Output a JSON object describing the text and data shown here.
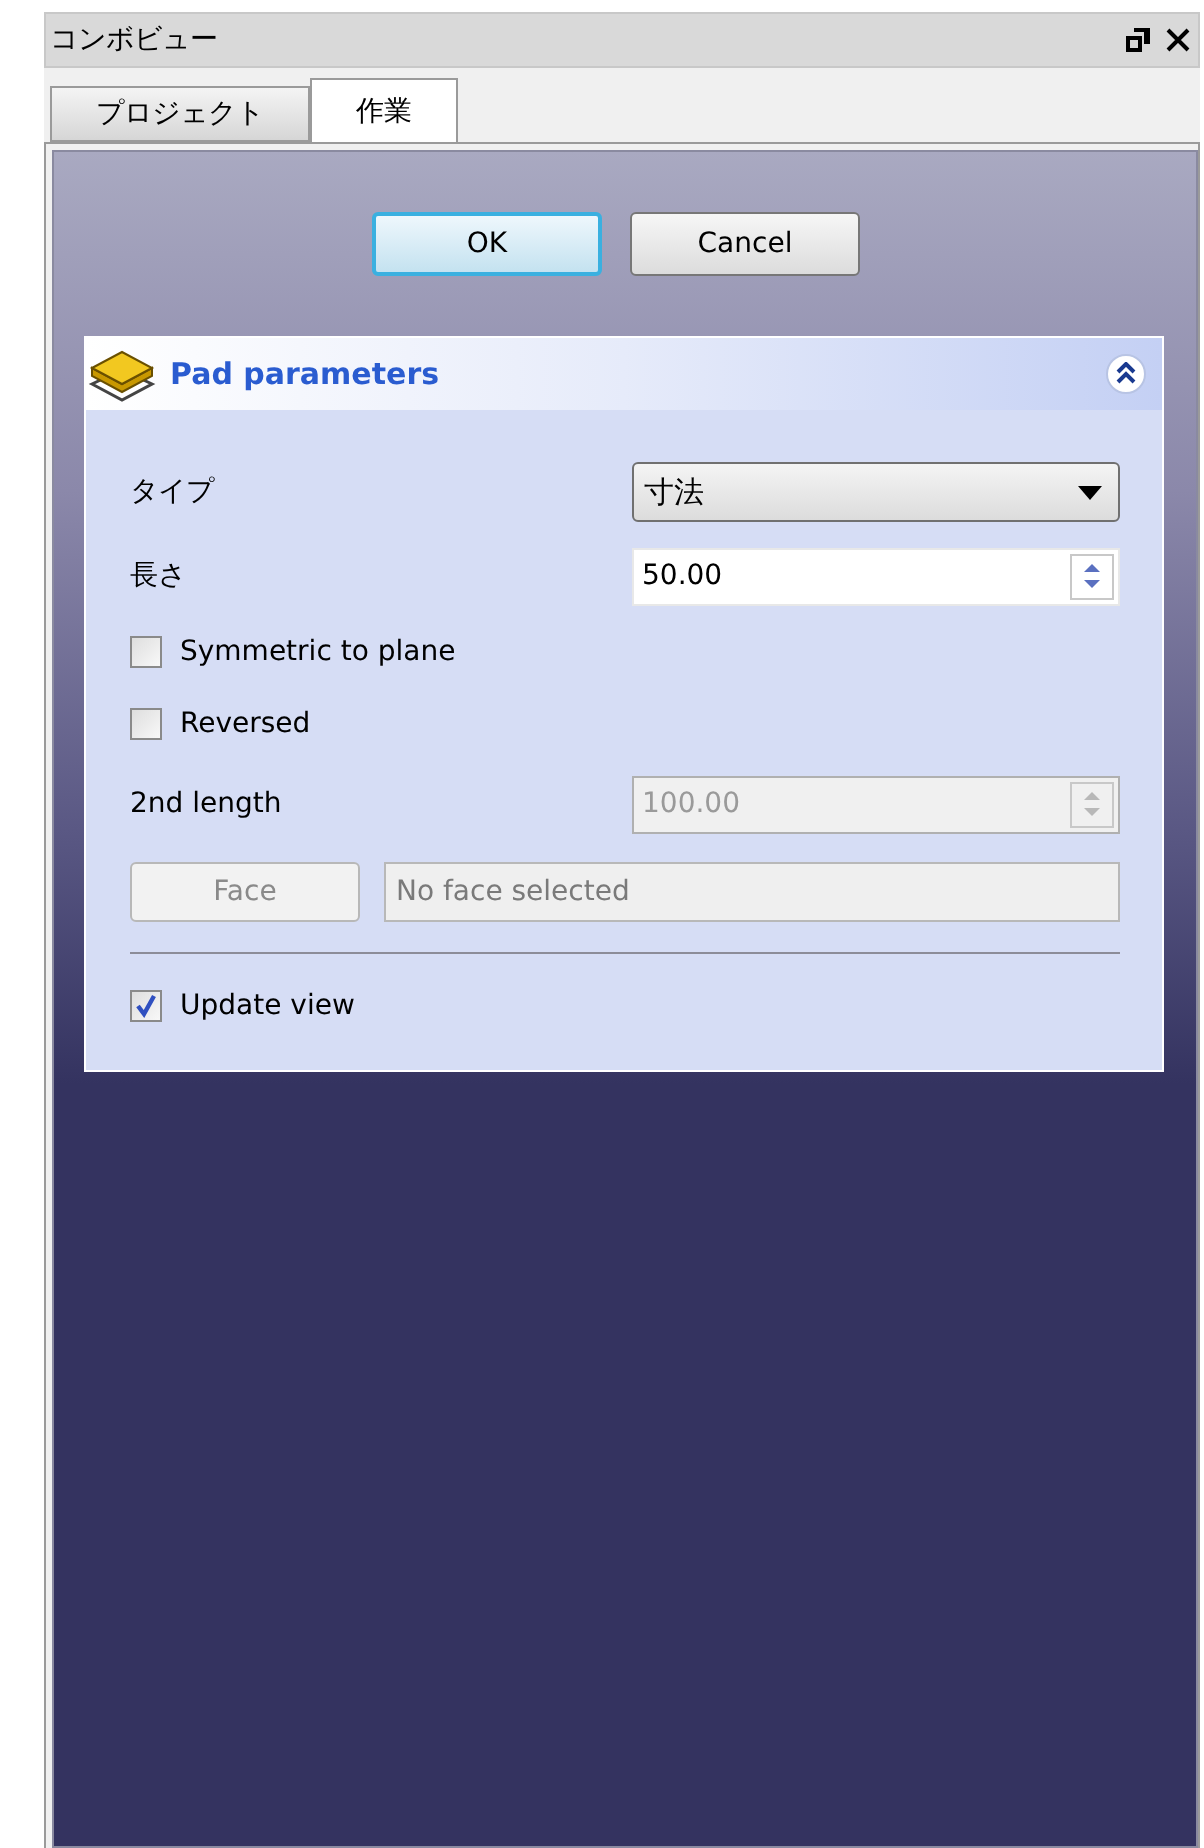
{
  "panel": {
    "title": "コンボビュー"
  },
  "tabs": [
    {
      "label": "プロジェクト",
      "selected": false
    },
    {
      "label": "作業",
      "selected": true
    }
  ],
  "buttons": [
    {
      "label": "OK",
      "default": true
    },
    {
      "label": "Cancel",
      "default": false
    }
  ],
  "task": {
    "title": "Pad parameters",
    "expanded": true,
    "rows": [
      {
        "kind": "combo",
        "label": "タイプ",
        "value": "寸法"
      },
      {
        "kind": "spin",
        "label": "長さ",
        "value": "50.00",
        "disabled": false
      },
      {
        "kind": "checkbox",
        "label": "Symmetric to plane",
        "checked": false
      },
      {
        "kind": "checkbox",
        "label": "Reversed",
        "checked": false
      },
      {
        "kind": "spin",
        "label": "2nd length",
        "value": "100.00",
        "disabled": true
      },
      {
        "kind": "face",
        "button": "Face",
        "value": "No face selected",
        "disabled": true
      },
      {
        "kind": "separator"
      },
      {
        "kind": "checkbox",
        "label": "Update view",
        "checked": true
      }
    ]
  }
}
